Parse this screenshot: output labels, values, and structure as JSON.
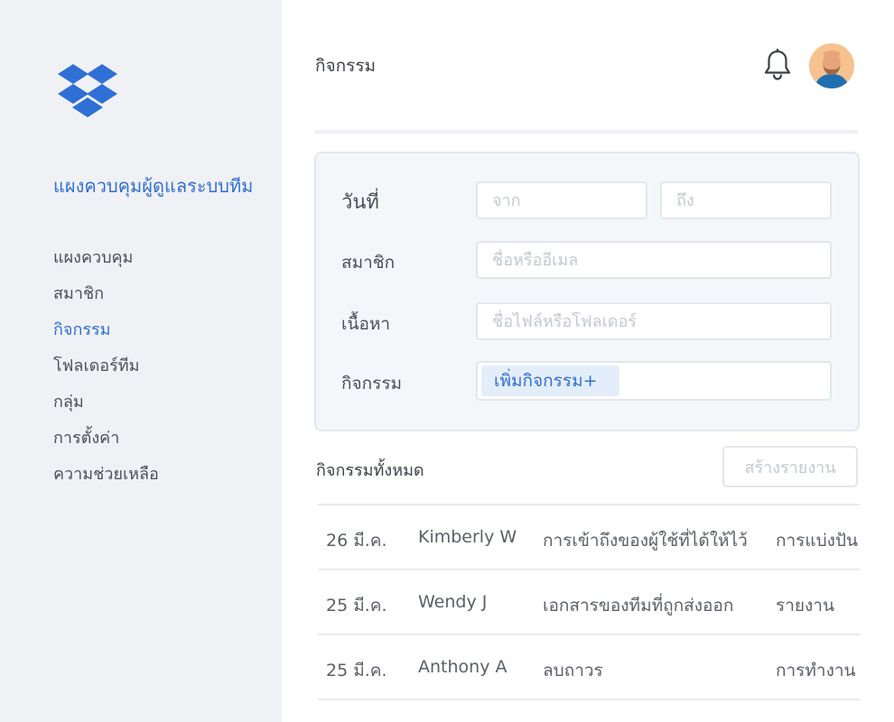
{
  "sidebar": {
    "logo": "dropbox-logo",
    "admin_title": "แผงควบคุมผู้ดูแลระบบทีม",
    "items": [
      {
        "label": "แผงควบคุม",
        "active": false
      },
      {
        "label": "สมาชิก",
        "active": false
      },
      {
        "label": "กิจกรรม",
        "active": true
      },
      {
        "label": "โฟลเดอร์ทีม",
        "active": false
      },
      {
        "label": "กลุ่ม",
        "active": false
      },
      {
        "label": "การตั้งค่า",
        "active": false
      },
      {
        "label": "ความช่วยเหลือ",
        "active": false
      }
    ]
  },
  "header": {
    "title": "กิจกรรม",
    "notification_icon": "bell-icon",
    "avatar": "user-avatar"
  },
  "filters": {
    "date": {
      "label": "วันที่",
      "from_placeholder": "จาก",
      "to_placeholder": "ถึง"
    },
    "member": {
      "label": "สมาชิก",
      "placeholder": "ชื่อหรืออีเมล"
    },
    "content": {
      "label": "เนื้อหา",
      "placeholder": "ชื่อไฟล์หรือโฟลเดอร์"
    },
    "activity": {
      "label": "กิจกรรม",
      "add_label": "เพิ่มกิจกรรม+"
    }
  },
  "activities": {
    "title": "กิจกรรมทั้งหมด",
    "create_report_label": "สร้างรายงาน",
    "rows": [
      {
        "date": "26 มี.ค.",
        "user": "Kimberly W",
        "description": "การเข้าถึงของผู้ใช้ที่ได้ให้ไว้",
        "type": "การแบ่งปัน"
      },
      {
        "date": "25 มี.ค.",
        "user": "Wendy J",
        "description": "เอกสารของทีมที่ถูกส่งออก",
        "type": "รายงาน"
      },
      {
        "date": "25 มี.ค.",
        "user": "Anthony A",
        "description": "ลบถาวร",
        "type": "การทำงาน"
      }
    ]
  },
  "colors": {
    "accent": "#2f6fd6",
    "sidebar_bg": "#f0f1f5",
    "panel_bg": "#f4f7fa"
  }
}
